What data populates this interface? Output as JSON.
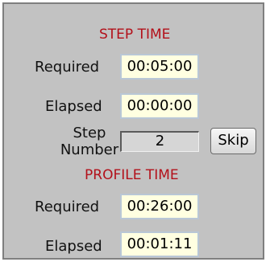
{
  "step_time": {
    "title": "STEP TIME",
    "required_label": "Required",
    "required_value": "00:05:00",
    "elapsed_label": "Elapsed",
    "elapsed_value": "00:00:00"
  },
  "step_number": {
    "label_line1": "Step",
    "label_line2": "Number",
    "value": "2",
    "skip_label": "Skip"
  },
  "profile_time": {
    "title": "PROFILE TIME",
    "required_label": "Required",
    "required_value": "00:26:00",
    "elapsed_label": "Elapsed",
    "elapsed_value": "00:01:11"
  },
  "colors": {
    "panel_bg": "#c2c2c2",
    "title_red": "#b3101a",
    "field_bg": "#ffffe1",
    "field_border": "#b9c7d6"
  }
}
